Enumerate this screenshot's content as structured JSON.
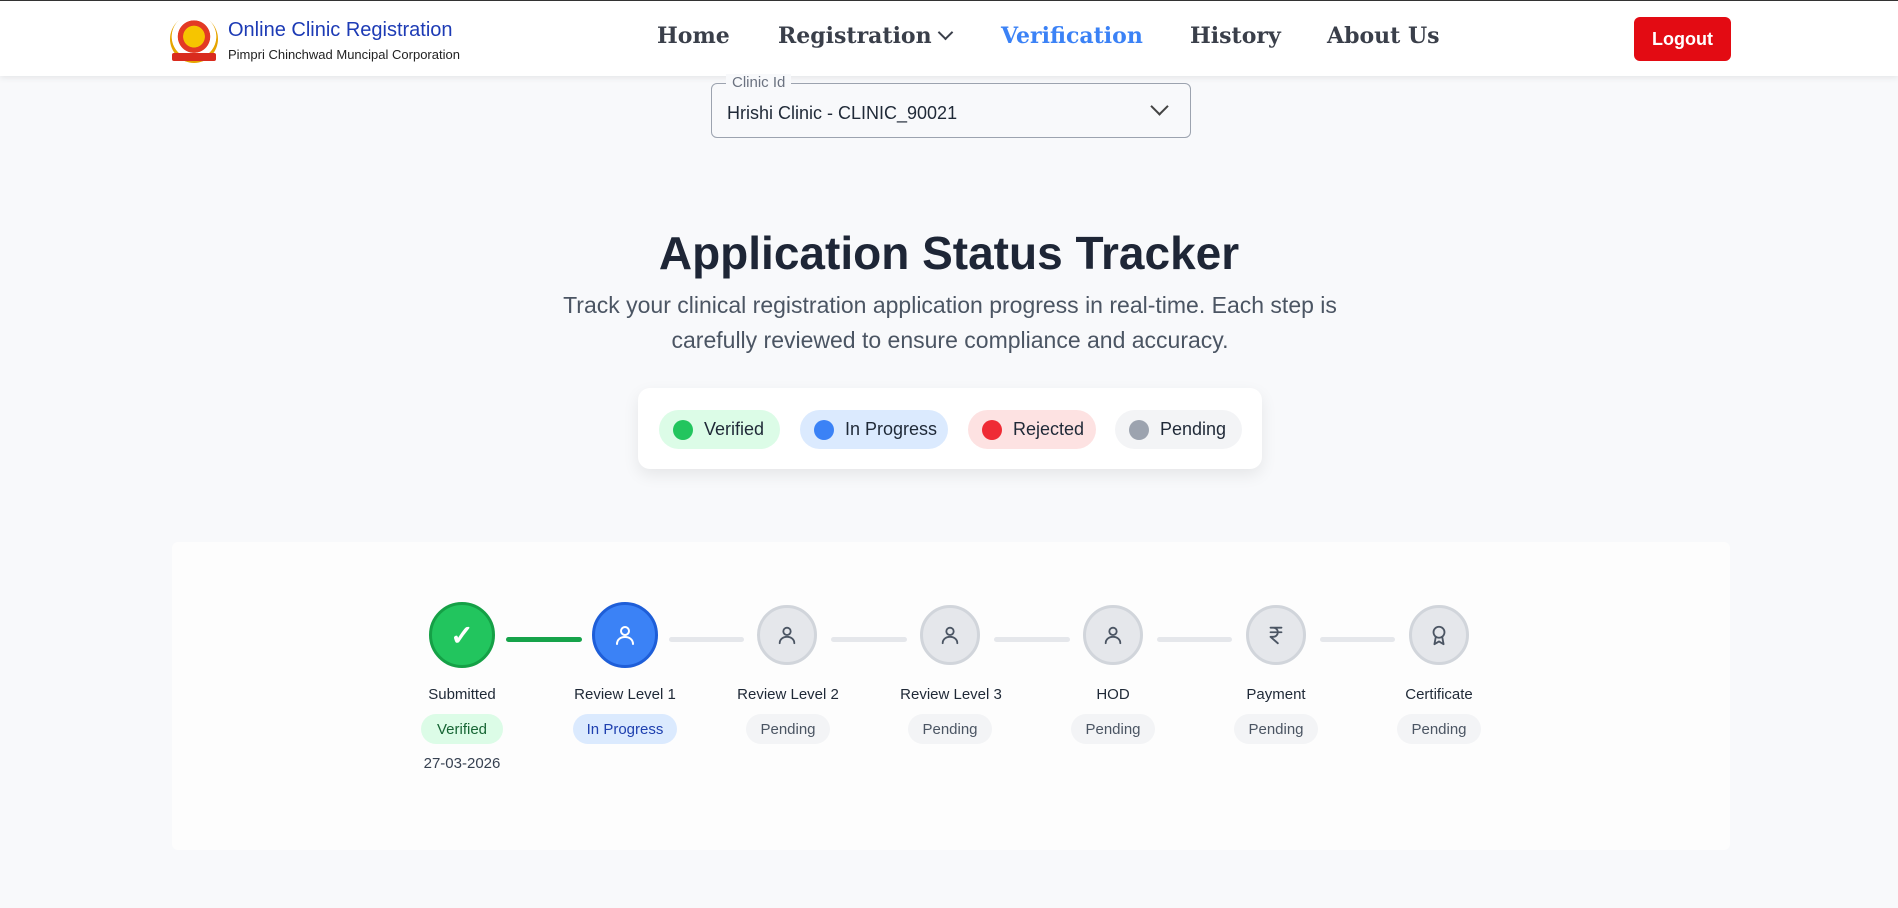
{
  "header": {
    "brand_title": "Online Clinic Registration",
    "brand_subtitle": "Pimpri Chinchwad Muncipal Corporation",
    "nav": [
      "Home",
      "Registration",
      "Verification",
      "History",
      "About Us"
    ],
    "active_nav": "Verification",
    "logout_label": "Logout"
  },
  "clinic_select": {
    "label": "Clinic Id",
    "value": "Hrishi Clinic - CLINIC_90021"
  },
  "hero": {
    "title": "Application Status Tracker",
    "description": "Track your clinical registration application progress in real-time. Each step is carefully reviewed to ensure compliance and accuracy."
  },
  "legend": [
    {
      "label": "Verified",
      "color": "#22c55e",
      "bg": "#dcfce7"
    },
    {
      "label": "In Progress",
      "color": "#3b82f6",
      "bg": "#dbeafe"
    },
    {
      "label": "Rejected",
      "color": "#ef2b35",
      "bg": "#fde2e2"
    },
    {
      "label": "Pending",
      "color": "#9ca3af",
      "bg": "#f3f4f6"
    }
  ],
  "steps": [
    {
      "label": "Submitted",
      "status": "Verified",
      "date": "27-03-2026",
      "icon": "check-icon"
    },
    {
      "label": "Review Level 1",
      "status": "In Progress",
      "icon": "user-icon"
    },
    {
      "label": "Review Level 2",
      "status": "Pending",
      "icon": "user-icon"
    },
    {
      "label": "Review Level 3",
      "status": "Pending",
      "icon": "user-icon"
    },
    {
      "label": "HOD",
      "status": "Pending",
      "icon": "user-icon"
    },
    {
      "label": "Payment",
      "status": "Pending",
      "icon": "rupee-icon"
    },
    {
      "label": "Certificate",
      "status": "Pending",
      "icon": "award-icon"
    }
  ]
}
